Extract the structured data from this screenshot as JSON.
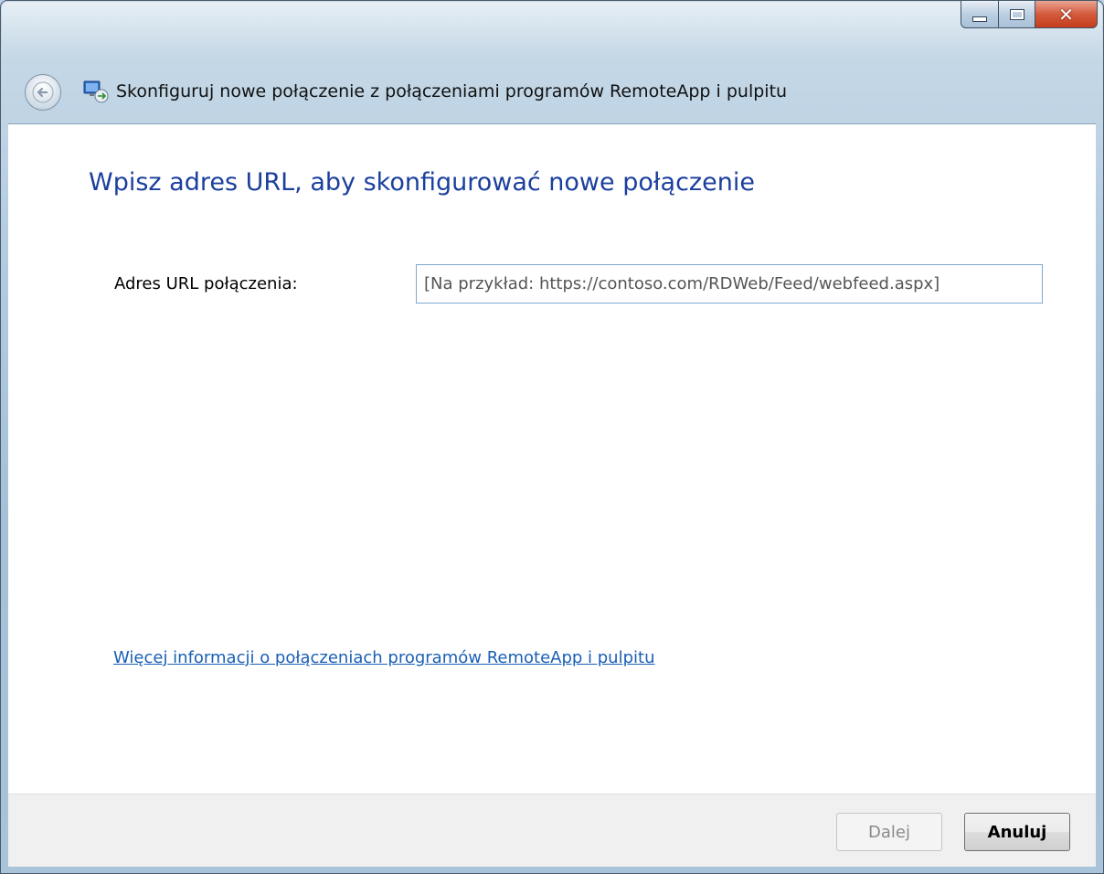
{
  "window": {
    "title": "Skonfiguruj nowe połączenie z połączeniami programów RemoteApp i pulpitu",
    "caption_buttons": [
      "minimize-icon",
      "maximize-icon",
      "close-icon"
    ]
  },
  "page": {
    "heading": "Wpisz adres URL, aby skonfigurować nowe połączenie",
    "url_label": "Adres URL połączenia:",
    "url_placeholder": "[Na przykład: https://contoso.com/RDWeb/Feed/webfeed.aspx]",
    "url_value": "",
    "info_link": "Więcej informacji o połączeniach programów RemoteApp i pulpitu"
  },
  "footer": {
    "next_label": "Dalej",
    "next_enabled": false,
    "cancel_label": "Anuluj"
  },
  "colors": {
    "heading": "#1b3f9e",
    "link": "#1a5fb4",
    "close_button": "#c33d1b"
  }
}
